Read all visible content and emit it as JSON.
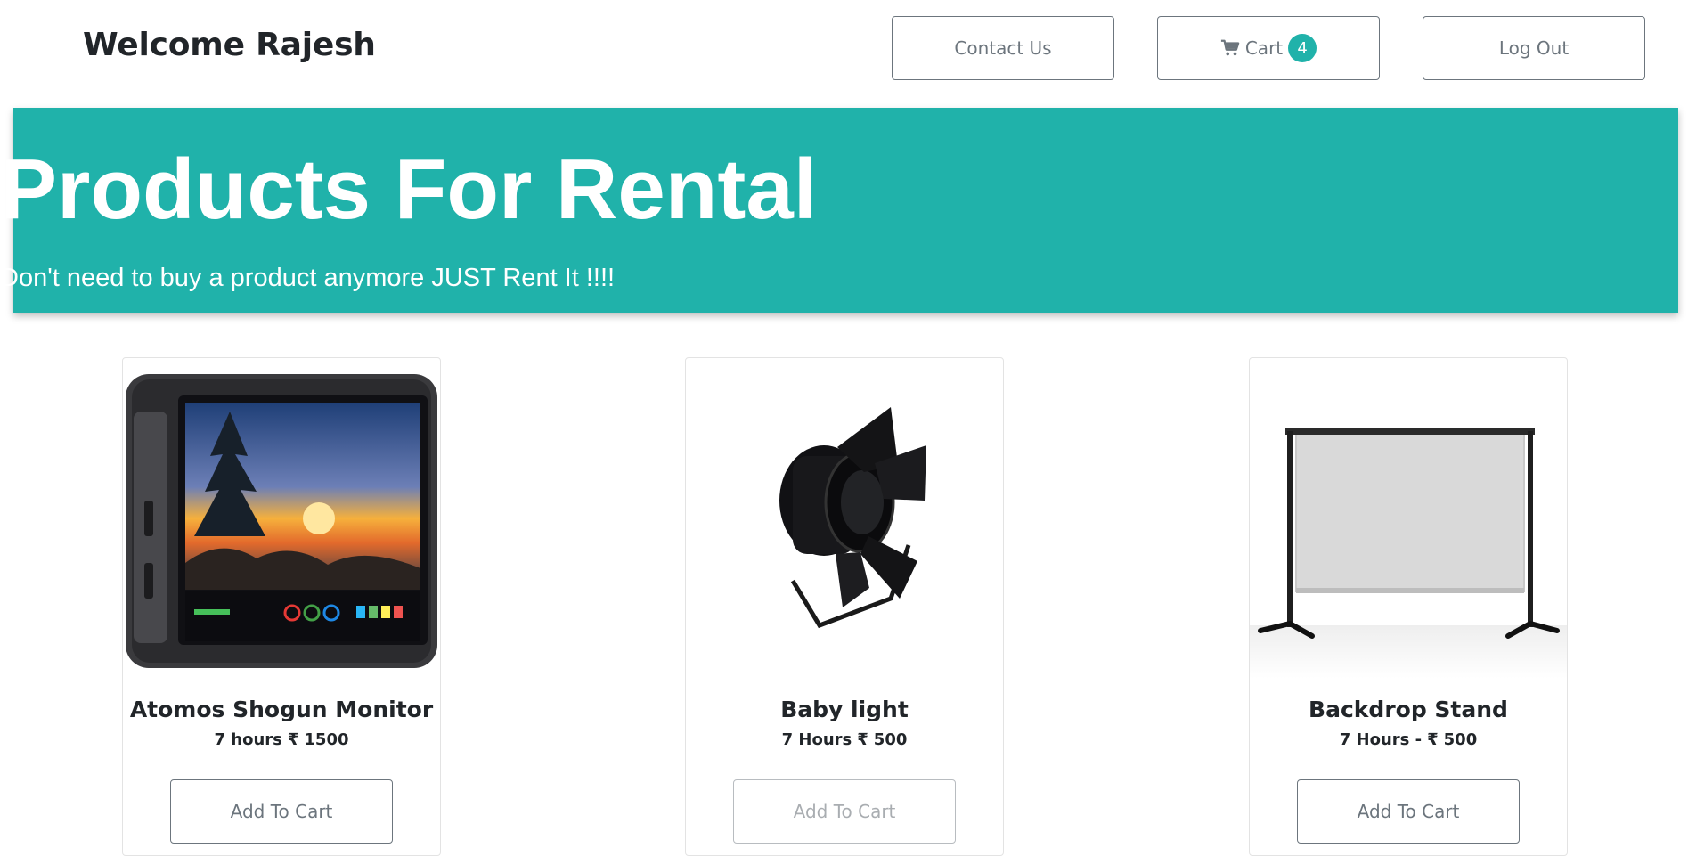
{
  "header": {
    "welcome": "Welcome Rajesh",
    "contact_label": "Contact Us",
    "cart_label": "Cart",
    "cart_count": "4",
    "logout_label": "Log Out"
  },
  "banner": {
    "title": "Products For Rental",
    "subtitle": "Don't need to buy a product anymore JUST Rent It !!!!"
  },
  "colors": {
    "accent": "#20b2aa",
    "button_text": "#6c757d"
  },
  "currency_symbol": "₹",
  "products": [
    {
      "name": "Atomos Shogun Monitor",
      "duration": "7 hours",
      "price": "1500",
      "button": "Add To Cart",
      "image_icon": "field-monitor-image"
    },
    {
      "name": "Baby light",
      "duration": "7 Hours",
      "price": "500",
      "button": "Add To Cart",
      "image_icon": "spotlight-image"
    },
    {
      "name": "Backdrop Stand",
      "duration": "7 Hours -",
      "price": "500",
      "button": "Add To Cart",
      "image_icon": "backdrop-stand-image"
    }
  ]
}
